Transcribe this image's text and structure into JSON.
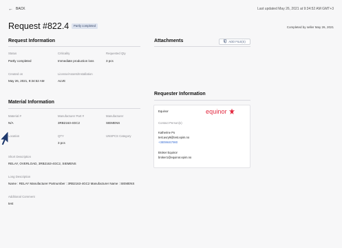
{
  "header": {
    "back_label": "BACK",
    "last_updated": "Last updated May 26, 2021 at 9:34:52 AM GMT+3"
  },
  "request": {
    "title": "Request #822.4",
    "status_badge": "Partly completed",
    "completed_by": "Completed by seller May 26, 2021"
  },
  "request_info": {
    "heading": "Request Information",
    "status_label": "Status",
    "status_value": "Partly completed",
    "criticality_label": "Criticality",
    "criticality_value": "Immediate production loss",
    "requested_qty_label": "Requested Qty",
    "requested_qty_value": "3 pcs",
    "created_label": "Created on",
    "created_value": "May 26, 2021, 9:34:52 AM",
    "license_label": "License/Assets/Installation",
    "license_value": "ALVE"
  },
  "attachments": {
    "heading": "Attachments",
    "add_files_label": "ADD FILE(S)"
  },
  "material_info": {
    "heading": "Material Information",
    "material_label": "Material #",
    "material_value": "N/A",
    "mfr_part_label": "Manufacturer Part #",
    "mfr_part_value": "3RB2163-4GC2",
    "manufacturer_label": "Manufacturer",
    "manufacturer_value": "SIEMENS",
    "location_label": "Location",
    "location_value": "",
    "qty_label": "QTY",
    "qty_value": "3 pcs",
    "unspcs_label": "UNSPCS Category",
    "unspcs_value": "",
    "short_desc_label": "Short Description",
    "short_desc_value": "RELAY, OVERLOAD, 3RB2163-4GC2, SIEMENS",
    "long_desc_label": "Long Description",
    "long_desc_value": "Name : RELAY Manufacturer Partnumber : 3RB2163-4GC2 Manufacturer Name : SIEMENS",
    "comment_label": "Additional Comment",
    "comment_value": "test"
  },
  "requester": {
    "heading": "Requester Information",
    "company": "Equinor",
    "logo_text": "equinor",
    "contacts_label": "Contact Person(s)",
    "contact_name": "Katherine Po",
    "contact_email": "test.avry9@test.epim.no",
    "contact_phone": "+38099467980",
    "broker_name": "Broker Equinor",
    "broker_email": "broker1@equinor.epim.no"
  },
  "colors": {
    "brand_red": "#e2243b",
    "link_blue": "#3b6fd4",
    "badge_bg": "#dde3ef"
  }
}
